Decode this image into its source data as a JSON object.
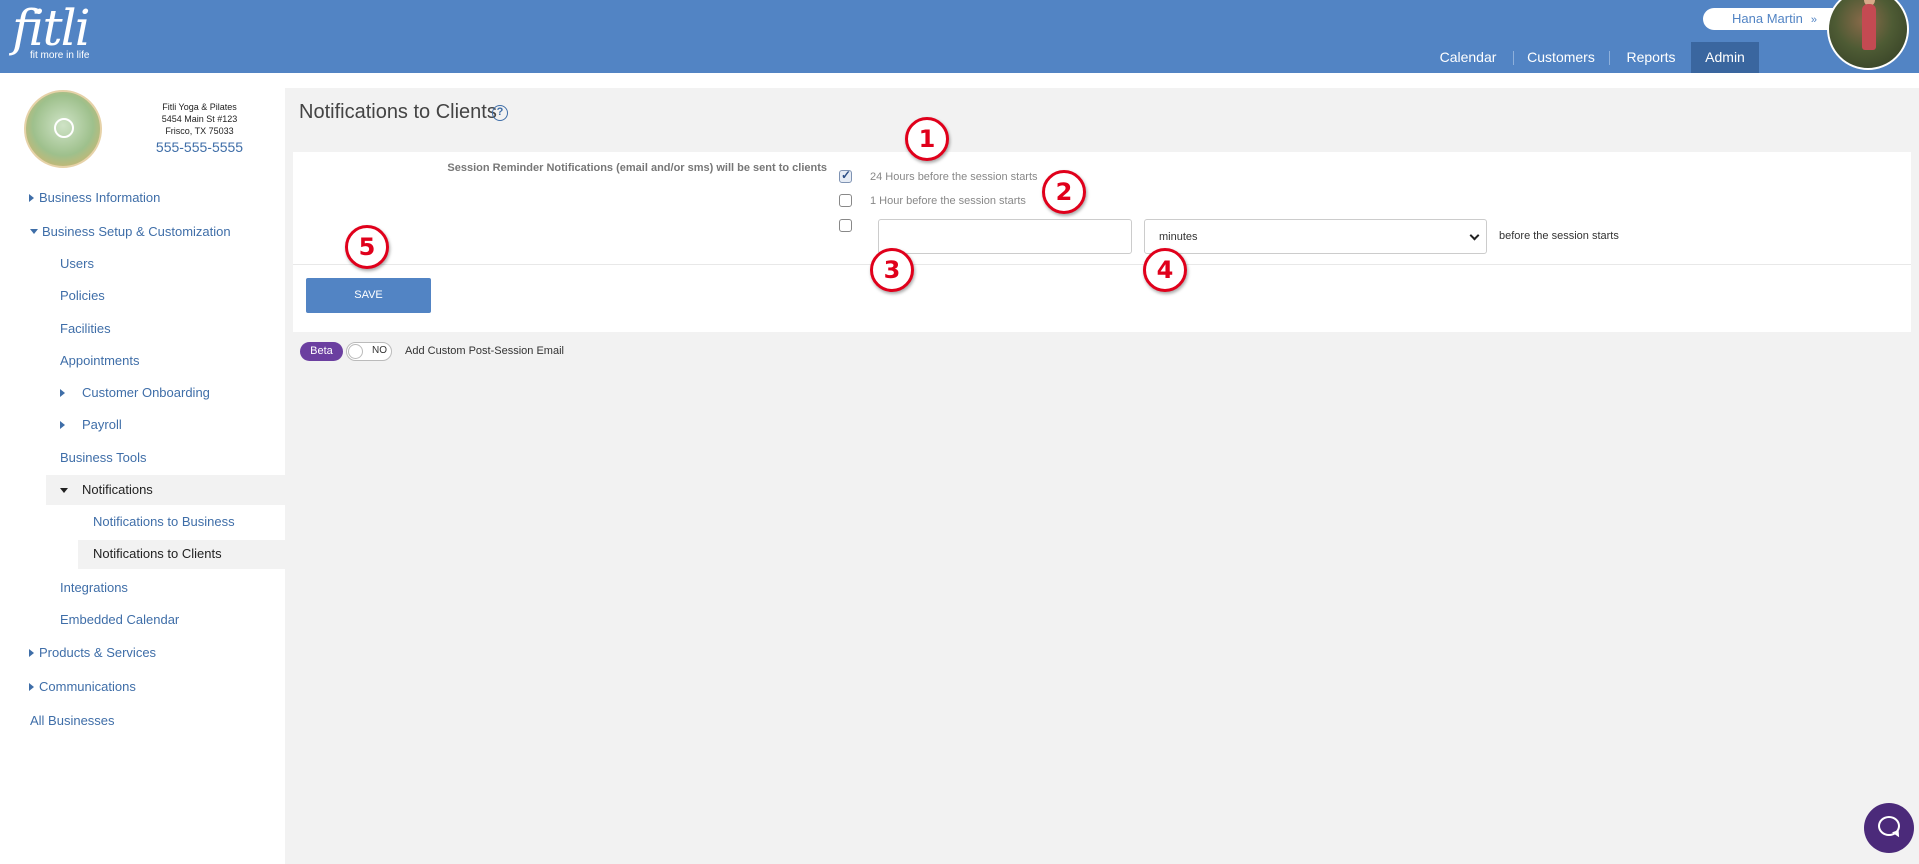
{
  "app": {
    "logo_text": "fitli",
    "logo_tagline": "fit more in life",
    "brand_color": "#5284c4"
  },
  "header": {
    "user_name": "Hana Martin",
    "user_chevron": "»",
    "nav": [
      {
        "label": "Calendar",
        "active": false
      },
      {
        "label": "Customers",
        "active": false
      },
      {
        "label": "Reports",
        "active": false
      },
      {
        "label": "Admin",
        "active": true
      }
    ]
  },
  "business": {
    "name": "Fitli Yoga & Pilates",
    "address1": "5454 Main St #123",
    "address2": "Frisco, TX 75033",
    "phone": "555-555-5555"
  },
  "sidebar": {
    "items": [
      {
        "label": "Business Information"
      },
      {
        "label": "Business Setup & Customization"
      },
      {
        "label": "Users"
      },
      {
        "label": "Policies"
      },
      {
        "label": "Facilities"
      },
      {
        "label": "Appointments"
      },
      {
        "label": "Customer Onboarding"
      },
      {
        "label": "Payroll"
      },
      {
        "label": "Business Tools"
      },
      {
        "label": "Notifications"
      },
      {
        "label": "Notifications to Business"
      },
      {
        "label": "Notifications to Clients"
      },
      {
        "label": "Integrations"
      },
      {
        "label": "Embedded Calendar"
      },
      {
        "label": "Products & Services"
      },
      {
        "label": "Communications"
      },
      {
        "label": "All Businesses"
      }
    ]
  },
  "main": {
    "title": "Notifications to Clients",
    "help_icon": "?",
    "reminder_label": "Session Reminder Notifications (email and/or sms) will be sent to clients",
    "options": [
      {
        "label": "24 Hours before the session starts",
        "checked": true
      },
      {
        "label": "1 Hour before the session starts",
        "checked": false
      },
      {
        "label": "",
        "checked": false
      }
    ],
    "custom_amount_value": "",
    "unit_select_value": "minutes",
    "after_select_text": "before the session starts",
    "save_label": "SAVE",
    "beta_label": "Beta",
    "toggle_label": "NO",
    "post_session_label": "Add Custom Post-Session Email"
  },
  "annotations": {
    "m1": "1",
    "m2": "2",
    "m3": "3",
    "m4": "4",
    "m5": "5"
  }
}
